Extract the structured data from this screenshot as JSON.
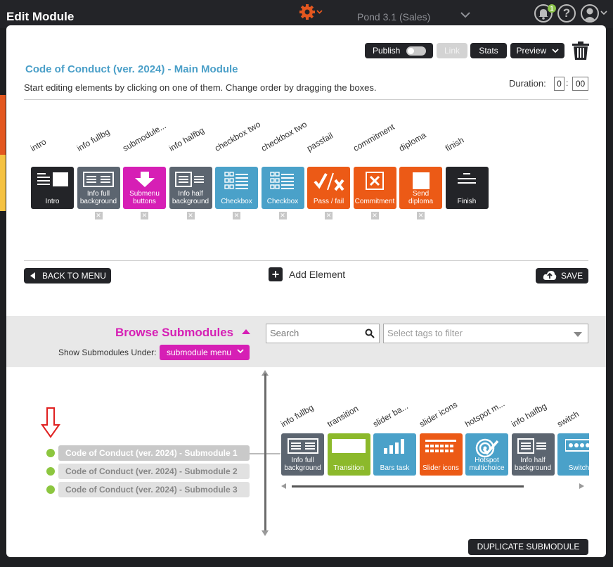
{
  "header": {
    "title": "Edit Module",
    "project": "Pond 3.1 (Sales)",
    "notification_count": "1",
    "help_glyph": "?"
  },
  "toolbar": {
    "publish": "Publish",
    "link": "Link",
    "stats": "Stats",
    "preview": "Preview"
  },
  "module": {
    "title": "Code of Conduct (ver. 2024) - Main Module",
    "instructions": "Start editing elements by clicking on one of them. Change order by dragging the boxes.",
    "duration_label": "Duration:",
    "duration_min": "0",
    "duration_sec": "00"
  },
  "elements": [
    {
      "name": "intro",
      "label": "Intro",
      "color": "#232428",
      "icon": "intro-icon"
    },
    {
      "name": "info fullbg",
      "label": "Info full background",
      "color": "#5c6570",
      "icon": "info-full-icon"
    },
    {
      "name": "submodule...",
      "label": "Submenu buttons",
      "color": "#d61fb5",
      "icon": "arrow-down-icon"
    },
    {
      "name": "info halfbg",
      "label": "Info half background",
      "color": "#5c6570",
      "icon": "info-half-icon"
    },
    {
      "name": "checkbox two",
      "label": "Checkbox",
      "color": "#4aa1c9",
      "icon": "checkbox-icon"
    },
    {
      "name": "checkbox two",
      "label": "Checkbox",
      "color": "#4aa1c9",
      "icon": "checkbox-icon"
    },
    {
      "name": "passfail",
      "label": "Pass / fail",
      "color": "#ec5a16",
      "icon": "pass-fail-icon"
    },
    {
      "name": "commitment",
      "label": "Commitment",
      "color": "#ec5a16",
      "icon": "commitment-icon"
    },
    {
      "name": "diploma",
      "label": "Send diploma",
      "color": "#ec5a16",
      "icon": "diploma-icon"
    },
    {
      "name": "finish",
      "label": "Finish",
      "color": "#232428",
      "icon": "finish-icon"
    }
  ],
  "actions": {
    "back": "BACK TO MENU",
    "add": "Add Element",
    "save": "SAVE",
    "duplicate": "DUPLICATE SUBMODULE"
  },
  "browse": {
    "title": "Browse Submodules",
    "show_label": "Show Submodules Under:",
    "menu_value": "submodule menu",
    "search_placeholder": "Search",
    "tags_placeholder": "Select tags to filter"
  },
  "submodules": [
    {
      "label": "Code of Conduct (ver. 2024) - Submodule 1",
      "selected": true
    },
    {
      "label": "Code of Conduct (ver. 2024) - Submodule 2",
      "selected": false
    },
    {
      "label": "Code of Conduct (ver. 2024) - Submodule 3",
      "selected": false
    }
  ],
  "sub_elements": [
    {
      "name": "info fullbg",
      "label": "Info full background",
      "color": "#5c6570",
      "icon": "info-full-icon"
    },
    {
      "name": "transition",
      "label": "Transition",
      "color": "#8cb92b",
      "icon": "transition-icon"
    },
    {
      "name": "slider ba...",
      "label": "Bars task",
      "color": "#4aa1c9",
      "icon": "bars-icon"
    },
    {
      "name": "slider icons",
      "label": "Slider icons",
      "color": "#ec5a16",
      "icon": "slider-icon"
    },
    {
      "name": "hotspot m...",
      "label": "Hotspot multichoice",
      "color": "#4aa1c9",
      "icon": "hotspot-icon"
    },
    {
      "name": "info halfbg",
      "label": "Info half background",
      "color": "#5c6570",
      "icon": "info-half-icon"
    },
    {
      "name": "switch",
      "label": "Switch",
      "color": "#4aa1c9",
      "icon": "switch-icon"
    }
  ]
}
